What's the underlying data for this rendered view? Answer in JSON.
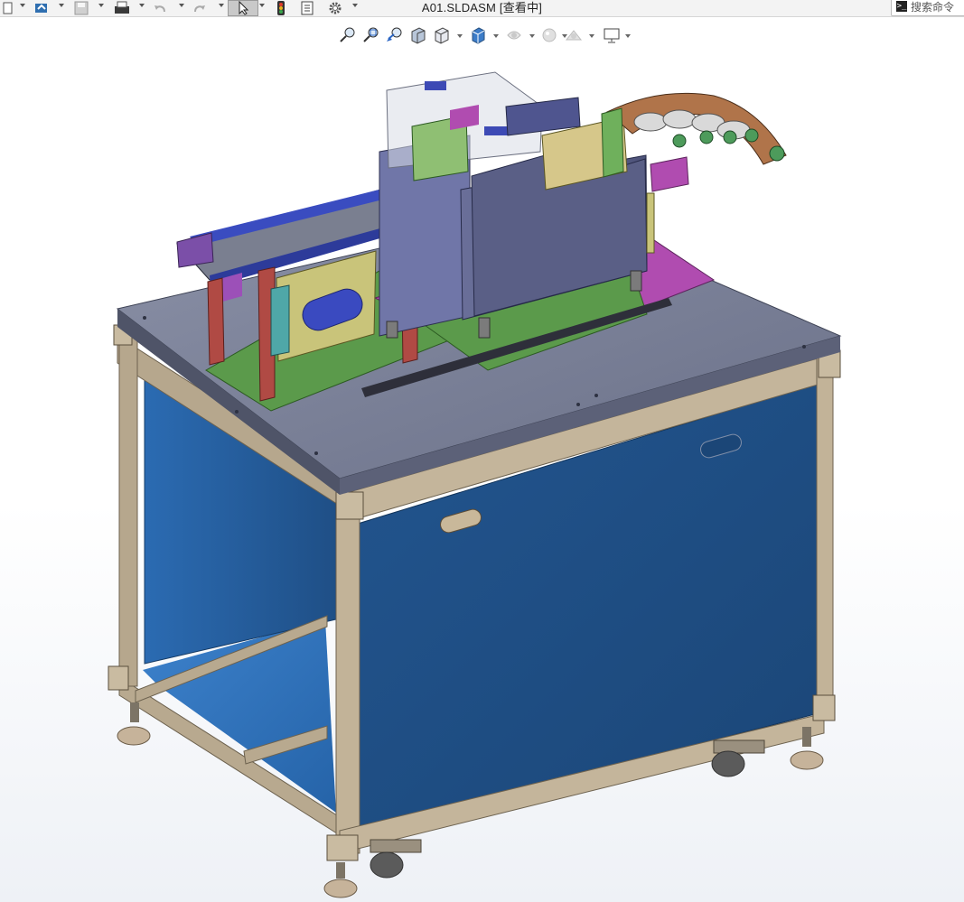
{
  "window": {
    "title": "A01.SLDASM [查看中]"
  },
  "toolbar": {
    "items": [
      {
        "name": "new-document-icon",
        "has_menu": true
      },
      {
        "name": "open-icon",
        "has_menu": true
      },
      {
        "name": "save-icon",
        "has_menu": true
      },
      {
        "name": "print-icon",
        "has_menu": true
      },
      {
        "name": "undo-icon",
        "has_menu": true
      },
      {
        "name": "redo-icon",
        "has_menu": true
      },
      {
        "name": "select-icon",
        "has_menu": true,
        "active": true
      },
      {
        "name": "rebuild-traffic-light-icon",
        "has_menu": false
      },
      {
        "name": "file-properties-icon",
        "has_menu": false
      },
      {
        "name": "options-gear-icon",
        "has_menu": true
      }
    ]
  },
  "command_search": {
    "placeholder": "搜索命令"
  },
  "view_toolbar": {
    "items": [
      "zoom-to-fit-icon",
      "zoom-to-area-icon",
      "previous-view-icon",
      "section-view-icon",
      "dynamic-annotation-icon",
      "view-orientation-icon",
      "display-style-icon",
      "hide-show-items-icon",
      "edit-appearance-icon",
      "apply-scene-icon",
      "view-settings-icon"
    ]
  },
  "colors": {
    "frame": "#b9aa90",
    "panel": "#1f4f86",
    "table_top": "#777d94",
    "plate_green": "#5b9a4b",
    "plate_magenta": "#b04cb0",
    "housing": "#5a5f86",
    "accent_blue": "#2d3b9a"
  }
}
